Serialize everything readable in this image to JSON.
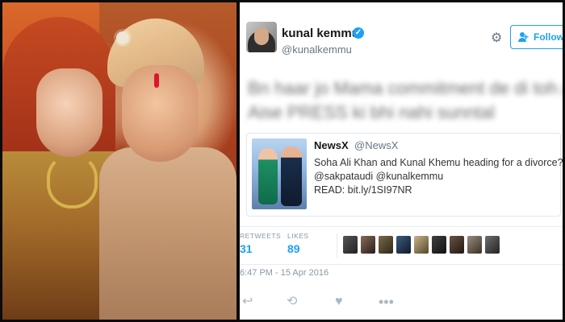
{
  "tweet": {
    "author_name": "kunal kemmu",
    "author_handle": "@kunalkemmu",
    "follow_label": "Follow",
    "blurred_line_1": "Bn haar jo Mama commitment de di toh phir",
    "blurred_line_2": "Aise PRESS ki bhi nahi sunntal",
    "quoted": {
      "name": "NewsX",
      "handle": "@NewsX",
      "line_1": "Soha Ali Khan and Kunal Khemu heading for a divorce?",
      "line_2": "@sakpataudi @kunalkemmu",
      "line_3": "READ: bit.ly/1SI97NR"
    },
    "stats": {
      "retweets_label": "RETWEETS",
      "retweets_value": "31",
      "likes_label": "LIKES",
      "likes_value": "89"
    },
    "timestamp": "6:47 PM - 15 Apr 2016"
  },
  "colors": {
    "accent": "#1da1f2",
    "muted": "#8899a6",
    "text": "#14171a"
  },
  "icons": {
    "verified": "verified-badge-icon",
    "settings": "gear-icon",
    "follow": "follow-person-plus-icon",
    "reply": "reply-icon",
    "retweet": "retweet-icon",
    "like": "heart-icon",
    "more": "more-dots-icon"
  }
}
